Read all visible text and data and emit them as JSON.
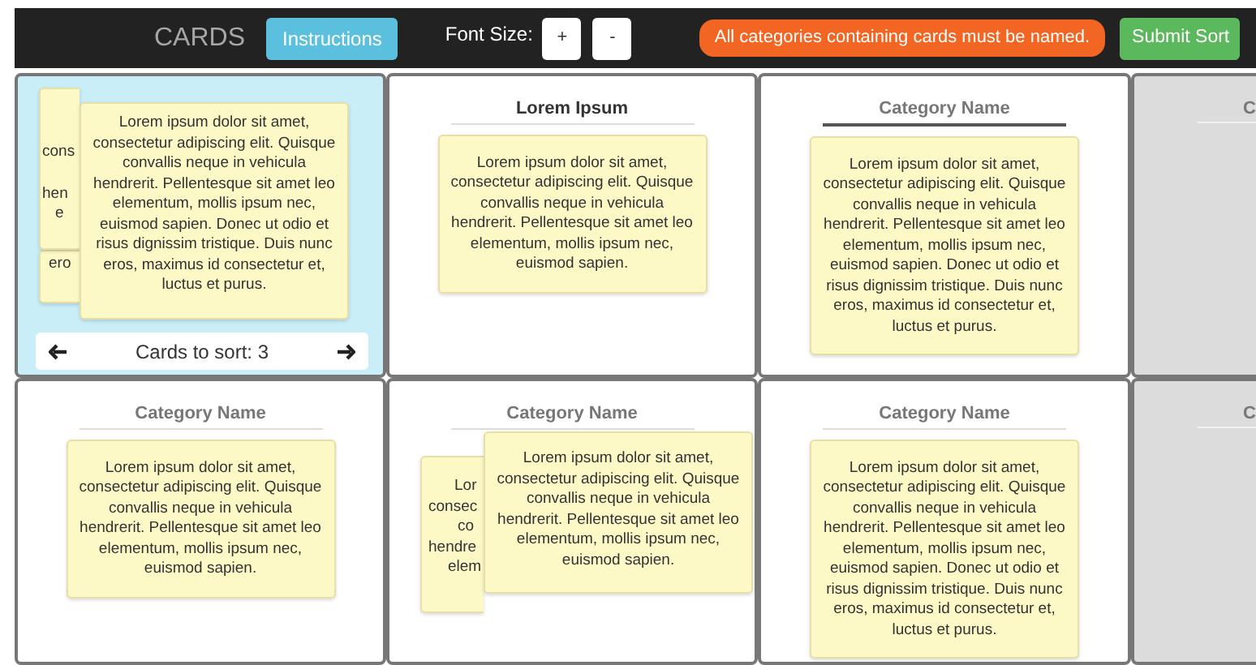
{
  "header": {
    "title": "CARDS",
    "instructions_button": "Instructions",
    "font_size_label": "Font Size:",
    "font_buttons": [
      "+",
      "-"
    ],
    "alert": "All categories containing cards must be named.",
    "submit_button": "Submit Sort"
  },
  "cells": [
    {
      "kind": "deck",
      "stack": [
        {
          "fragments": [
            "cons",
            "hen",
            "e"
          ]
        },
        {
          "fragments": [
            "ero"
          ]
        }
      ],
      "top_card": "Lorem ipsum dolor sit amet, consectetur adipiscing elit. Quisque convallis neque in vehicula hendrerit. Pellentesque sit amet leo elementum, mollis ipsum nec, euismod sapien. Donec ut odio et risus dignissim tristique. Duis nunc eros, maximus id consectetur et, luctus et purus.",
      "deck_label": "Cards to sort: 3"
    },
    {
      "kind": "category",
      "name": {
        "value": "Lorem Ipsum"
      },
      "focused": false,
      "cards": [
        "Lorem ipsum dolor sit amet, consectetur adipiscing elit. Quisque convallis neque in vehicula hendrerit. Pellentesque sit amet leo elementum, mollis ipsum nec, euismod sapien."
      ]
    },
    {
      "kind": "category",
      "name": {
        "placeholder": "Category Name"
      },
      "focused": true,
      "cards": [
        "Lorem ipsum dolor sit amet, consectetur adipiscing elit. Quisque convallis neque in vehicula hendrerit. Pellentesque sit amet leo elementum, mollis ipsum nec, euismod sapien. Donec ut odio et risus dignissim tristique. Duis nunc eros, maximus id consectetur et, luctus et purus."
      ]
    },
    {
      "kind": "inactive",
      "name": {
        "placeholder": "C"
      }
    },
    {
      "kind": "category",
      "name": {
        "placeholder": "Category Name"
      },
      "focused": false,
      "cards": [
        "Lorem ipsum dolor sit amet, consectetur adipiscing elit. Quisque convallis neque in vehicula hendrerit. Pellentesque sit amet leo elementum, mollis ipsum nec, euismod sapien."
      ]
    },
    {
      "kind": "category",
      "name": {
        "placeholder": "Category Name"
      },
      "focused": false,
      "stack": [
        {
          "fragments": [
            "Lor",
            "consec",
            "co",
            "hendre",
            "elem"
          ]
        }
      ],
      "cards": [
        "Lorem ipsum dolor sit amet, consectetur adipiscing elit. Quisque convallis neque in vehicula hendrerit. Pellentesque sit amet leo elementum, mollis ipsum nec, euismod sapien."
      ]
    },
    {
      "kind": "category",
      "name": {
        "placeholder": "Category Name"
      },
      "focused": false,
      "cards": [
        "Lorem ipsum dolor sit amet, consectetur adipiscing elit. Quisque convallis neque in vehicula hendrerit. Pellentesque sit amet leo elementum, mollis ipsum nec, euismod sapien. Donec ut odio et risus dignissim tristique. Duis nunc eros, maximus id consectetur et, luctus et purus."
      ]
    },
    {
      "kind": "inactive",
      "name": {
        "placeholder": "C"
      }
    }
  ]
}
